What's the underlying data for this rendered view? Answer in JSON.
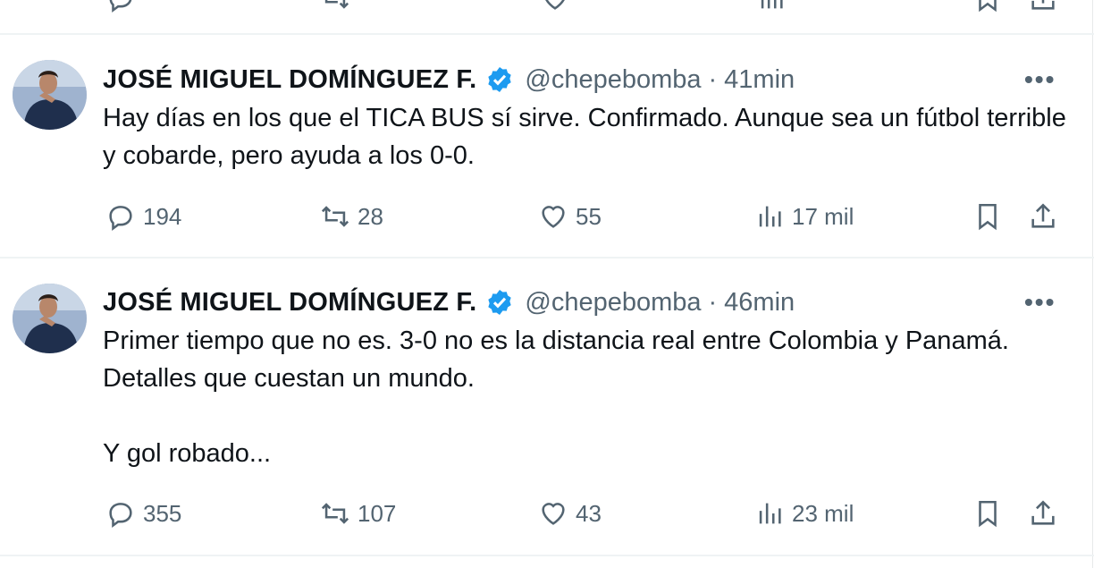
{
  "tweets": [
    {
      "name": "JOSÉ MIGUEL DOMÍNGUEZ F.",
      "handle": "@chepebomba",
      "separator": "·",
      "time": "41min",
      "text": "Hay días en los que el TICA BUS sí sirve. Confirmado. Aunque sea un fútbol terrible y cobarde, pero ayuda a los 0-0.",
      "replies": "194",
      "retweets": "28",
      "likes": "55",
      "views": "17 mil"
    },
    {
      "name": "JOSÉ MIGUEL DOMÍNGUEZ F.",
      "handle": "@chepebomba",
      "separator": "·",
      "time": "46min",
      "text": "Primer tiempo que no es. 3-0 no es la distancia real entre Colombia y Panamá. Detalles que cuestan un mundo.\n\nY gol robado...",
      "replies": "355",
      "retweets": "107",
      "likes": "43",
      "views": "23 mil"
    }
  ],
  "more_glyph": "•••",
  "colors": {
    "verified": "#1d9bf0",
    "muted": "#536471",
    "text": "#0f1419"
  }
}
